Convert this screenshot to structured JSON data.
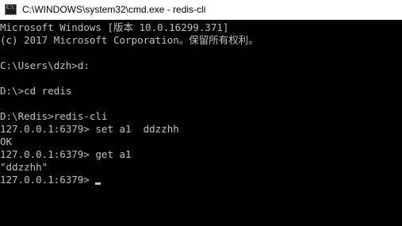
{
  "window": {
    "title": "C:\\WINDOWS\\system32\\cmd.exe - redis-cli",
    "icon": "cmd-console-icon",
    "icon_text": "C:\\"
  },
  "colors": {
    "background": "#000000",
    "text": "#c0c0c0",
    "titlebar": "#ffffff"
  },
  "console": {
    "lines": [
      "Microsoft Windows [版本 10.0.16299.371]",
      "(c) 2017 Microsoft Corporation。保留所有权利。",
      "C:\\Users\\dzh>d:",
      "D:\\>cd redis",
      "D:\\Redis>redis-cli",
      "127.0.0.1:6379> set a1  ddzzhh",
      "OK",
      "127.0.0.1:6379> get a1",
      "\"ddzzhh\"",
      "127.0.0.1:6379> "
    ]
  }
}
